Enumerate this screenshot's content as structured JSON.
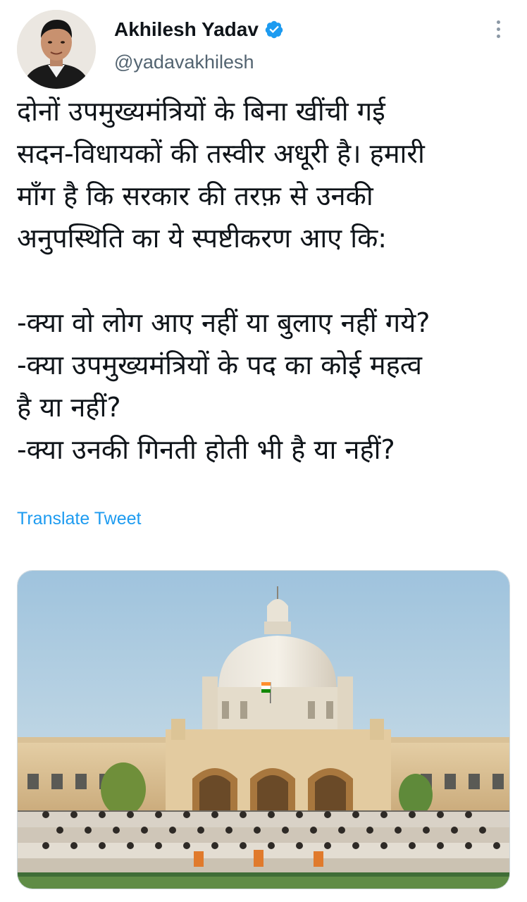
{
  "tweet": {
    "author": {
      "display_name": "Akhilesh Yadav",
      "handle": "@yadavakhilesh",
      "verified_icon": "verified-badge-icon",
      "avatar": "profile-photo"
    },
    "more_icon": "more-vertical-icon",
    "text_lines": [
      "दोनों उपमुख्यमंत्रियों के बिना खींची गई",
      "सदन-विधायकों की तस्वीर अधूरी है। हमारी",
      "माँग है कि सरकार की तरफ़ से उनकी",
      "अनुपस्थिति का ये स्पष्टीकरण आए कि:",
      "-क्या वो लोग आए नहीं या बुलाए नहीं गये?",
      "-क्या उपमुख्यमंत्रियों के पद का कोई महत्व",
      "है या नहीं?",
      "-क्या उनकी गिनती होती भी है या नहीं?"
    ],
    "translate_label": "Translate Tweet",
    "media": {
      "type": "photo",
      "subject": "group photo in front of domed legislative building"
    },
    "colors": {
      "link": "#1d9bf0",
      "verified": "#1d9bf0",
      "secondary_text": "#536471"
    }
  }
}
